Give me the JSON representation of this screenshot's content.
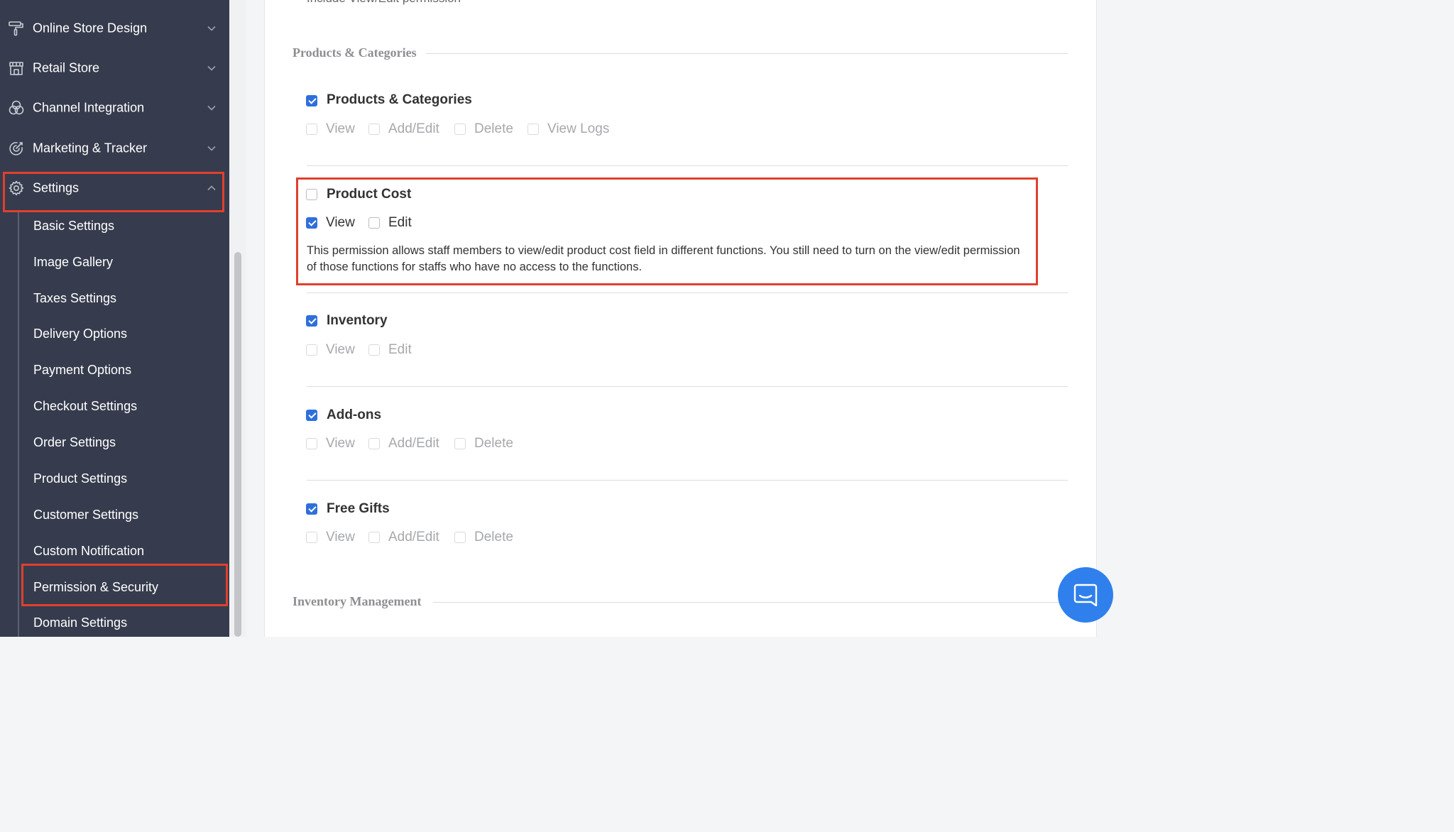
{
  "sidebar": {
    "menu": [
      {
        "label": "Online Store Design",
        "icon": "paint-roller-icon"
      },
      {
        "label": "Retail Store",
        "icon": "storefront-icon"
      },
      {
        "label": "Channel Integration",
        "icon": "channels-icon"
      },
      {
        "label": "Marketing & Tracker",
        "icon": "target-icon"
      },
      {
        "label": "Settings",
        "icon": "gear-icon"
      }
    ],
    "settings_submenu": [
      "Basic Settings",
      "Image Gallery",
      "Taxes Settings",
      "Delivery Options",
      "Payment Options",
      "Checkout Settings",
      "Order Settings",
      "Product Settings",
      "Customer Settings",
      "Custom Notification",
      "Permission & Security",
      "Domain Settings"
    ]
  },
  "main": {
    "top_cut_text": "Include View/Edit permission",
    "section_products": "Products & Categories",
    "section_inventory_mgmt": "Inventory Management",
    "permissions": {
      "products_categories": {
        "title": "Products & Categories",
        "checked": true,
        "options": [
          {
            "label": "View",
            "checked": false
          },
          {
            "label": "Add/Edit",
            "checked": false
          },
          {
            "label": "Delete",
            "checked": false
          },
          {
            "label": "View Logs",
            "checked": false
          }
        ]
      },
      "product_cost": {
        "title": "Product Cost",
        "checked": false,
        "options": [
          {
            "label": "View",
            "checked": true
          },
          {
            "label": "Edit",
            "checked": false
          }
        ],
        "description": "This permission allows staff members to view/edit product cost field in different functions. You still need to turn on the view/edit permission of those functions for staffs who have no access to the functions."
      },
      "inventory": {
        "title": "Inventory",
        "checked": true,
        "options": [
          {
            "label": "View",
            "checked": false
          },
          {
            "label": "Edit",
            "checked": false
          }
        ]
      },
      "addons": {
        "title": "Add-ons",
        "checked": true,
        "options": [
          {
            "label": "View",
            "checked": false
          },
          {
            "label": "Add/Edit",
            "checked": false
          },
          {
            "label": "Delete",
            "checked": false
          }
        ]
      },
      "free_gifts": {
        "title": "Free Gifts",
        "checked": true,
        "options": [
          {
            "label": "View",
            "checked": false
          },
          {
            "label": "Add/Edit",
            "checked": false
          },
          {
            "label": "Delete",
            "checked": false
          }
        ]
      }
    }
  },
  "colors": {
    "sidebar_bg": "#363c4d",
    "highlight": "#e0402e",
    "checkbox_accent": "#2f6fdc",
    "chat_button": "#2f80ed"
  },
  "icons": {
    "chat": "chat-icon",
    "chevron_down": "chevron-down-icon",
    "chevron_up": "chevron-up-icon"
  }
}
